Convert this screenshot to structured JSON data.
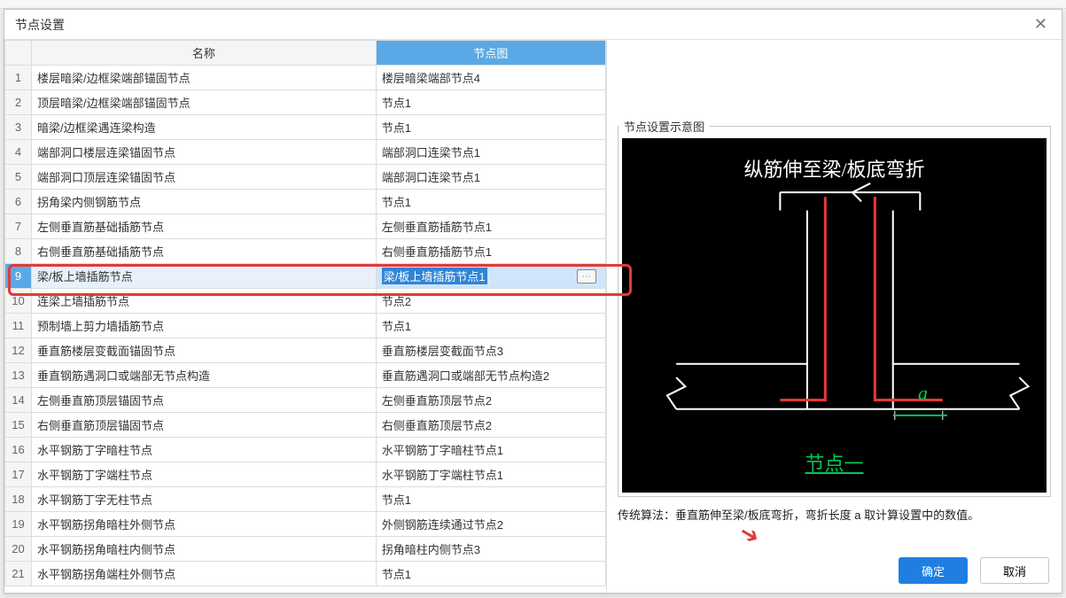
{
  "title": "节点设置",
  "columns": {
    "index": "",
    "name": "名称",
    "node": "节点图"
  },
  "preview": {
    "legend": "节点设置示意图",
    "heading": "纵筋伸至梁/板底弯折",
    "node_label": "节点一",
    "var_a": "a",
    "algo": "传统算法：垂直筋伸至梁/板底弯折，弯折长度 a 取计算设置中的数值。"
  },
  "buttons": {
    "ok": "确定",
    "cancel": "取消"
  },
  "selected_index": 8,
  "rows": [
    {
      "n": "1",
      "name": "楼层暗梁/边框梁端部锚固节点",
      "node": "楼层暗梁端部节点4"
    },
    {
      "n": "2",
      "name": "顶层暗梁/边框梁端部锚固节点",
      "node": "节点1"
    },
    {
      "n": "3",
      "name": "暗梁/边框梁遇连梁构造",
      "node": "节点1"
    },
    {
      "n": "4",
      "name": "端部洞口楼层连梁锚固节点",
      "node": "端部洞口连梁节点1"
    },
    {
      "n": "5",
      "name": "端部洞口顶层连梁锚固节点",
      "node": "端部洞口连梁节点1"
    },
    {
      "n": "6",
      "name": "拐角梁内侧钢筋节点",
      "node": "节点1"
    },
    {
      "n": "7",
      "name": "左侧垂直筋基础插筋节点",
      "node": "左侧垂直筋插筋节点1"
    },
    {
      "n": "8",
      "name": "右侧垂直筋基础插筋节点",
      "node": "右侧垂直筋插筋节点1"
    },
    {
      "n": "9",
      "name": "梁/板上墙插筋节点",
      "node": "梁/板上墙插筋节点1"
    },
    {
      "n": "10",
      "name": "连梁上墙插筋节点",
      "node": "节点2"
    },
    {
      "n": "11",
      "name": "预制墙上剪力墙插筋节点",
      "node": "节点1"
    },
    {
      "n": "12",
      "name": "垂直筋楼层变截面锚固节点",
      "node": "垂直筋楼层变截面节点3"
    },
    {
      "n": "13",
      "name": "垂直钢筋遇洞口或端部无节点构造",
      "node": "垂直筋遇洞口或端部无节点构造2"
    },
    {
      "n": "14",
      "name": "左侧垂直筋顶层锚固节点",
      "node": "左侧垂直筋顶层节点2"
    },
    {
      "n": "15",
      "name": "右侧垂直筋顶层锚固节点",
      "node": "右侧垂直筋顶层节点2"
    },
    {
      "n": "16",
      "name": "水平钢筋丁字暗柱节点",
      "node": "水平钢筋丁字暗柱节点1"
    },
    {
      "n": "17",
      "name": "水平钢筋丁字端柱节点",
      "node": "水平钢筋丁字端柱节点1"
    },
    {
      "n": "18",
      "name": "水平钢筋丁字无柱节点",
      "node": "节点1"
    },
    {
      "n": "19",
      "name": "水平钢筋拐角暗柱外侧节点",
      "node": "外侧钢筋连续通过节点2"
    },
    {
      "n": "20",
      "name": "水平钢筋拐角暗柱内侧节点",
      "node": "拐角暗柱内侧节点3"
    },
    {
      "n": "21",
      "name": "水平钢筋拐角端柱外侧节点",
      "node": "节点1"
    }
  ]
}
